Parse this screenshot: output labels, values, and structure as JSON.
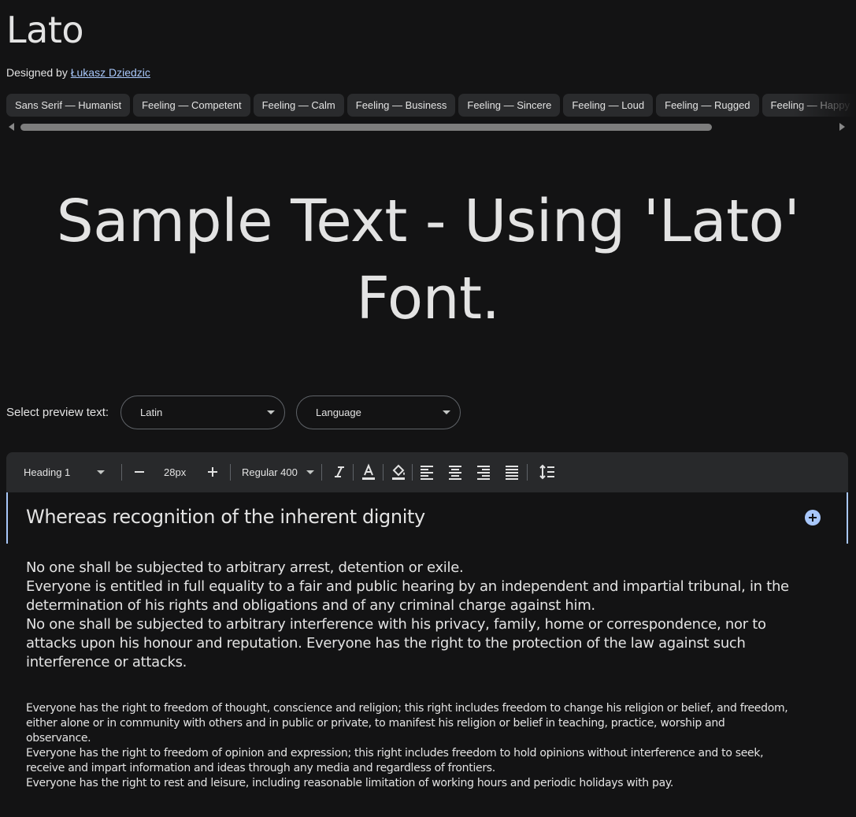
{
  "family": {
    "name": "Lato",
    "designed_by_label": "Designed by",
    "designer": "Łukasz Dziedzic"
  },
  "tags": [
    "Sans Serif — Humanist",
    "Feeling — Competent",
    "Feeling — Calm",
    "Feeling — Business",
    "Feeling — Sincere",
    "Feeling — Loud",
    "Feeling — Rugged",
    "Feeling — Happy"
  ],
  "hero": {
    "line1": "Sample Text - Using 'Lato'",
    "line2": "Font."
  },
  "preview": {
    "label": "Select preview text:",
    "script_value": "Latin",
    "language_value": "Language"
  },
  "toolbar": {
    "style_value": "Heading 1",
    "size_value": "28px",
    "weight_value": "Regular 400"
  },
  "editor": {
    "heading": "Whereas recognition of the inherent dignity",
    "body": [
      "No one shall be subjected to arbitrary arrest, detention or exile.",
      "Everyone is entitled in full equality to a fair and public hearing by an independent and impartial tribunal, in the determination of his rights and obligations and of any criminal charge against him.",
      "No one shall be subjected to arbitrary interference with his privacy, family, home or correspondence, nor to attacks upon his honour and reputation. Everyone has the right to the protection of the law against such interference or attacks."
    ],
    "small": [
      "Everyone has the right to freedom of thought, conscience and religion; this right includes freedom to change his religion or belief, and freedom, either alone or in community with others and in public or private, to manifest his religion or belief in teaching, practice, worship and observance.",
      "Everyone has the right to freedom of opinion and expression; this right includes freedom to hold opinions without interference and to seek, receive and impart information and ideas through any media and regardless of frontiers.",
      "Everyone has the right to rest and leisure, including reasonable limitation of working hours and periodic holidays with pay."
    ]
  },
  "colors": {
    "background": "#131314",
    "accent": "#a8c7fa",
    "chip": "#2a2b2d",
    "toolbar": "#28292b"
  }
}
